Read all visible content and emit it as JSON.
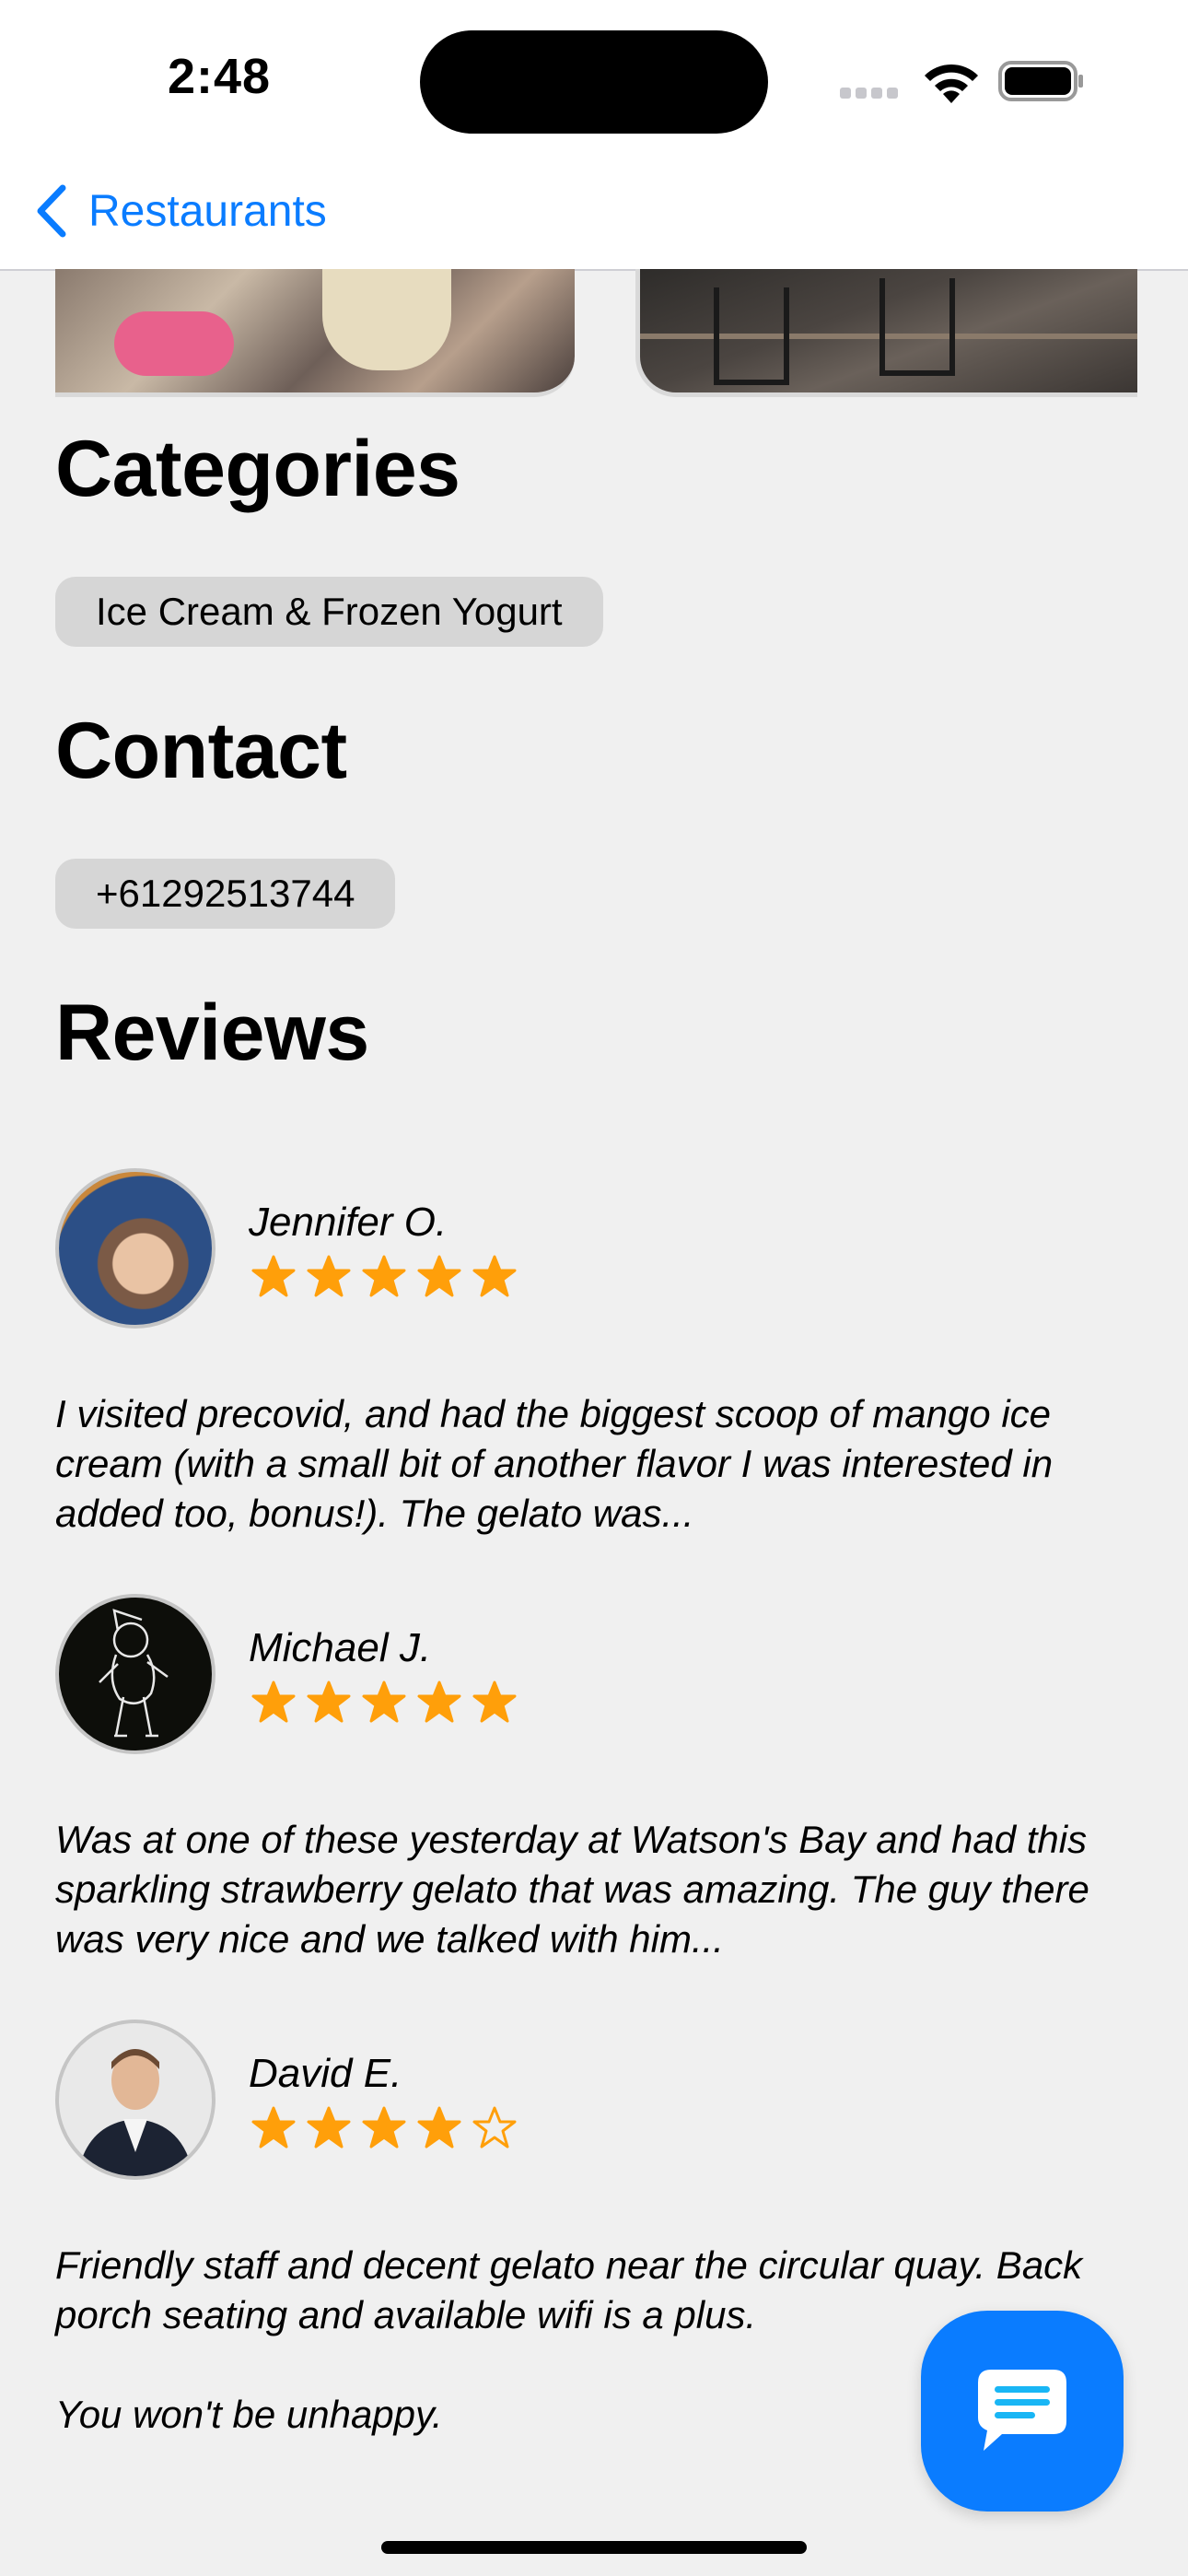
{
  "status_bar": {
    "time": "2:48"
  },
  "nav": {
    "back_label": "Restaurants"
  },
  "sections": {
    "categories_title": "Categories",
    "category_chip": "Ice Cream & Frozen Yogurt",
    "contact_title": "Contact",
    "phone": "+61292513744",
    "reviews_title": "Reviews"
  },
  "reviews": [
    {
      "name": "Jennifer O.",
      "rating": 5,
      "text": "I visited precovid, and had the biggest scoop of mango ice cream (with a small bit of another flavor I was interested in added too, bonus!). The gelato was..."
    },
    {
      "name": "Michael J.",
      "rating": 5,
      "text": "Was at one of these yesterday at Watson's Bay and had this sparkling strawberry gelato that was amazing. The guy there was very nice and we talked with him..."
    },
    {
      "name": "David E.",
      "rating": 4,
      "text_lines": [
        "Friendly staff and decent gelato near the circular quay. Back porch seating and available wifi is a plus.",
        "You won't be unhappy."
      ]
    }
  ],
  "colors": {
    "accent": "#0a7cff",
    "star": "#ff9f0a",
    "chip": "#d6d6d6",
    "background": "#f0f0f0"
  },
  "icons": {
    "back": "chevron-left-icon",
    "chat": "chat-bubble-icon",
    "star": "star-icon"
  }
}
